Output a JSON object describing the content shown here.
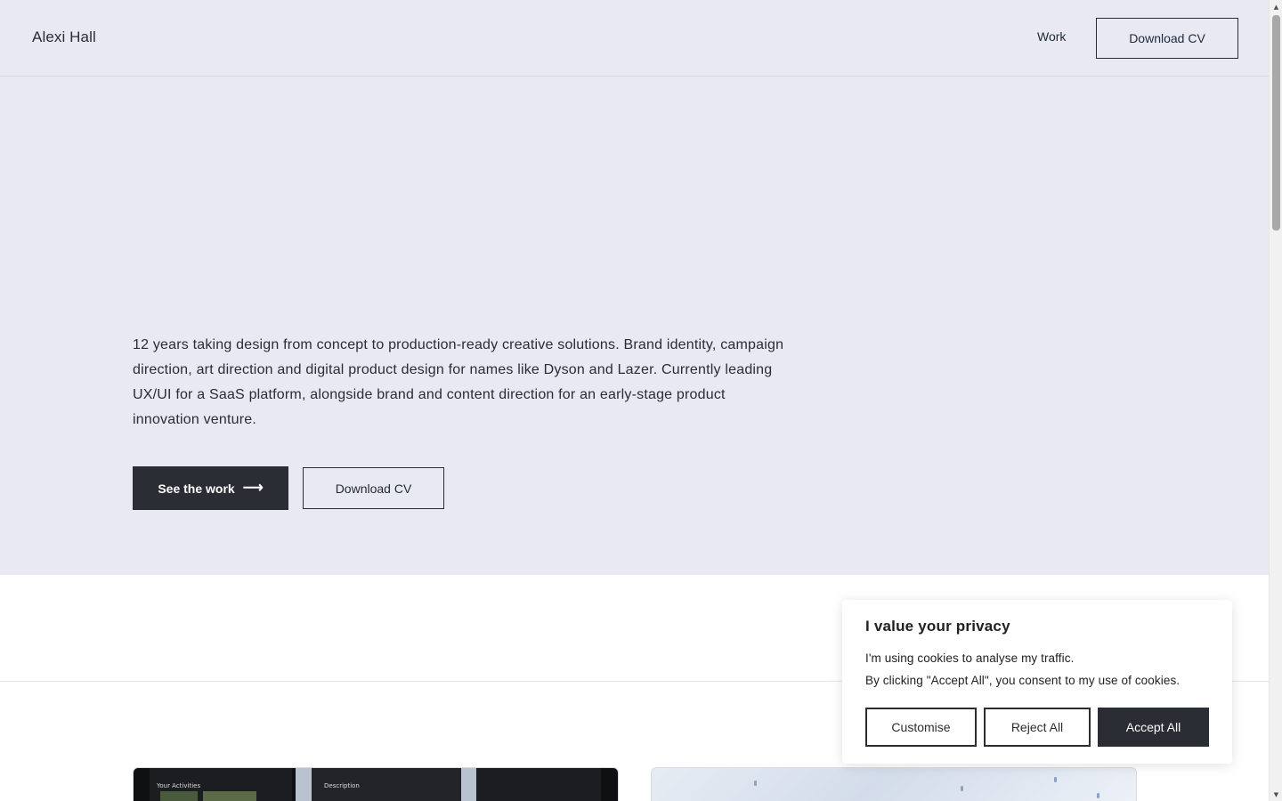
{
  "header": {
    "brand": "Alexi Hall",
    "nav_work": "Work",
    "nav_download": "Download CV"
  },
  "hero": {
    "intro": "12 years taking design from concept to production-ready creative solutions. Brand identity, campaign direction, art direction and digital product design for names like Dyson and Lazer. Currently leading UX/UI for a SaaS platform, alongside brand and content direction for an early-stage product innovation venture.",
    "primary_button": "See the work",
    "primary_button_icon": "arrow-right-icon",
    "primary_button_arrow": "⟶",
    "secondary_button": "Download CV"
  },
  "work_cards": [
    {
      "name": "project-card-app",
      "label_1": "Your Activities",
      "label_2": "Description"
    },
    {
      "name": "project-card-marble"
    }
  ],
  "cookie_banner": {
    "title": "I value your privacy",
    "line_1": "I'm using cookies to analyse my traffic.",
    "line_2": "By clicking \"Accept All\", you consent to my use of cookies.",
    "customise": "Customise",
    "reject": "Reject All",
    "accept": "Accept All"
  },
  "scrollbar": {
    "up_glyph": "▲",
    "down_glyph": "▼"
  },
  "colors": {
    "hero_bg": "#e8e9f3",
    "dark": "#2a2d34",
    "page_bg": "#ffffff"
  }
}
